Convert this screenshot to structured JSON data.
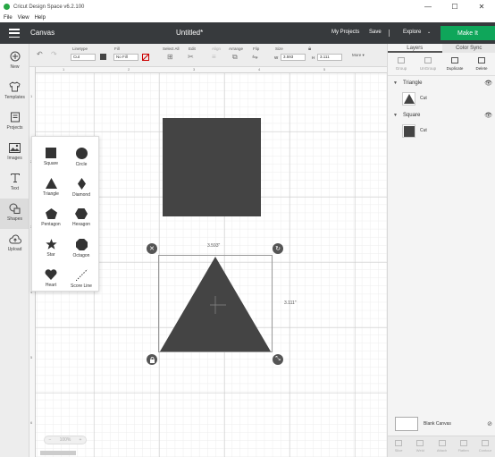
{
  "window": {
    "title": "Cricut Design Space  v6.2.100",
    "minimize": "—",
    "maximize": "☐",
    "close": "✕"
  },
  "menubar": [
    "File",
    "View",
    "Help"
  ],
  "header": {
    "canvas_label": "Canvas",
    "doc_title": "Untitled*",
    "my_projects": "My Projects",
    "save": "Save",
    "explore": "Explore",
    "explore_caret": "⌄",
    "make_it": "Make It"
  },
  "toolbar": {
    "linetype_label": "Linetype",
    "linetype_value": "Cut",
    "fill_label": "Fill",
    "fill_value": "No Fill",
    "select_all_label": "Select All",
    "edit_label": "Edit",
    "align_label": "Align",
    "arrange_label": "Arrange",
    "flip_label": "Flip",
    "size_label": "Size",
    "w_label": "W",
    "w_value": "3.593",
    "h_label": "H",
    "h_value": "3.111",
    "more_label": "More ▾"
  },
  "leftbar": [
    {
      "label": "New",
      "icon": "plus-circle-icon"
    },
    {
      "label": "Templates",
      "icon": "shirt-icon"
    },
    {
      "label": "Projects",
      "icon": "projects-icon"
    },
    {
      "label": "Images",
      "icon": "image-icon"
    },
    {
      "label": "Text",
      "icon": "text-icon"
    },
    {
      "label": "Shapes",
      "icon": "shapes-icon"
    },
    {
      "label": "Upload",
      "icon": "cloud-upload-icon"
    }
  ],
  "shapes_panel": {
    "items": [
      "Square",
      "Circle",
      "Triangle",
      "Diamond",
      "Pentagon",
      "Hexagon",
      "Star",
      "Octagon",
      "Heart",
      "Score Line"
    ]
  },
  "ruler": {
    "top": [
      "1",
      "2",
      "3",
      "4",
      "5"
    ],
    "left": [
      "1",
      "2",
      "3",
      "4",
      "5",
      "6"
    ]
  },
  "canvas": {
    "width_label": "3.593\"",
    "height_label": "3.111\"",
    "zoom_value": "100%"
  },
  "right_panel": {
    "tabs": [
      "Layers",
      "Color Sync"
    ],
    "actions": [
      "Group",
      "UnGroup",
      "Duplicate",
      "Delete"
    ],
    "layers": [
      {
        "name": "Triangle",
        "operation": "Cut"
      },
      {
        "name": "Square",
        "operation": "Cut"
      }
    ],
    "blank_canvas_label": "Blank Canvas",
    "bottom_actions": [
      "Slice",
      "Weld",
      "Attach",
      "Flatten",
      "Contour"
    ]
  },
  "colors": {
    "header_bg": "#373a3d",
    "make_it": "#0fa65a",
    "shape_fill": "#444444"
  }
}
